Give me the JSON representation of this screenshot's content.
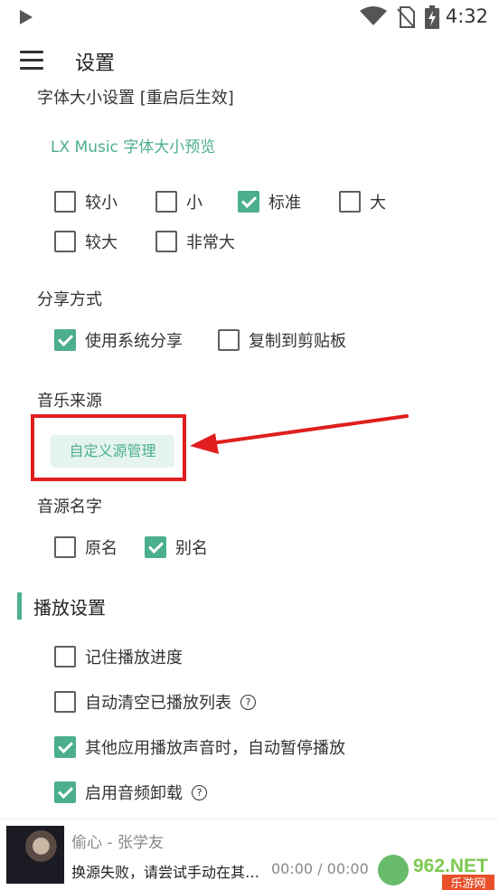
{
  "status_bar": {
    "time": "4:32"
  },
  "header": {
    "title": "设置"
  },
  "font_size": {
    "label": "字体大小设置 [重启后生效]",
    "preview": "LX Music 字体大小预览",
    "options": [
      {
        "label": "较小",
        "checked": false
      },
      {
        "label": "小",
        "checked": false
      },
      {
        "label": "标准",
        "checked": true
      },
      {
        "label": "大",
        "checked": false
      },
      {
        "label": "较大",
        "checked": false
      },
      {
        "label": "非常大",
        "checked": false
      }
    ]
  },
  "share": {
    "label": "分享方式",
    "options": [
      {
        "label": "使用系统分享",
        "checked": true
      },
      {
        "label": "复制到剪贴板",
        "checked": false
      }
    ]
  },
  "music_source": {
    "label": "音乐来源",
    "button": "自定义源管理"
  },
  "source_name": {
    "label": "音源名字",
    "options": [
      {
        "label": "原名",
        "checked": false
      },
      {
        "label": "别名",
        "checked": true
      }
    ]
  },
  "playback": {
    "title": "播放设置",
    "options": [
      {
        "label": "记住播放进度",
        "checked": false,
        "help": false
      },
      {
        "label": "自动清空已播放列表",
        "checked": false,
        "help": true
      },
      {
        "label": "其他应用播放声音时，自动暂停播放",
        "checked": true,
        "help": false
      },
      {
        "label": "启用音频卸载",
        "checked": true,
        "help": true
      }
    ]
  },
  "player": {
    "title": "偷心 - 张学友",
    "status": "换源失败，请尝试手动在其…",
    "time": "00:00 / 00:00"
  },
  "watermark": {
    "text": "962.NET",
    "subtext": "乐游网"
  },
  "colors": {
    "accent": "#4caf8c",
    "annotation": "#e01e1e"
  }
}
